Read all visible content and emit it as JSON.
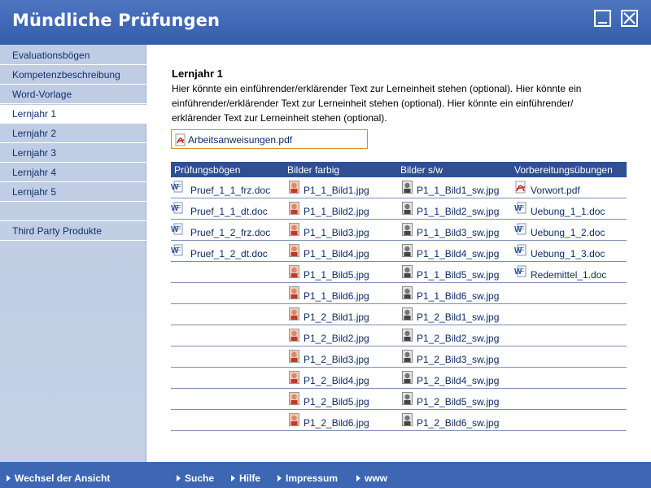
{
  "window": {
    "title": "Mündliche Prüfungen",
    "minimize_icon": "minimize-icon",
    "close_icon": "close-icon"
  },
  "sidebar": {
    "items": [
      {
        "label": "Evaluationsbögen",
        "active": false
      },
      {
        "label": "Kompetenzbeschreibung",
        "active": false
      },
      {
        "label": "Word-Vorlage",
        "active": false
      },
      {
        "label": "Lernjahr 1",
        "active": true
      },
      {
        "label": "Lernjahr 2",
        "active": false
      },
      {
        "label": "Lernjahr 3",
        "active": false
      },
      {
        "label": "Lernjahr 4",
        "active": false
      },
      {
        "label": "Lernjahr 5",
        "active": false
      },
      {
        "label": "Third Party Produkte",
        "active": false
      }
    ]
  },
  "main": {
    "title": "Lernjahr 1",
    "intro_line1": "Hier könnte ein einführender/erklärender Text zur Lerneinheit stehen (optional). Hier könnte ein",
    "intro_line2": "einführender/erklärender Text zur Lerneinheit stehen (optional). Hier könnte ein einführender/",
    "intro_line3": "erklärender Text zur Lerneinheit stehen (optional).",
    "featured_file": {
      "name": "Arbeitsanweisungen.pdf",
      "icon": "pdf-icon"
    },
    "table": {
      "headers": [
        "Prüfungsbögen",
        "Bilder farbig",
        "Bilder s/w",
        "Vorbereitungsübungen"
      ],
      "rows": [
        [
          "Pruef_1_1_frz.doc",
          "P1_1_Bild1.jpg",
          "P1_1_Bild1_sw.jpg",
          "Vorwort.pdf"
        ],
        [
          "Pruef_1_1_dt.doc",
          "P1_1_Bild2.jpg",
          "P1_1_Bild2_sw.jpg",
          "Uebung_1_1.doc"
        ],
        [
          "Pruef_1_2_frz.doc",
          "P1_1_Bild3.jpg",
          "P1_1_Bild3_sw.jpg",
          "Uebung_1_2.doc"
        ],
        [
          "Pruef_1_2_dt.doc",
          "P1_1_Bild4.jpg",
          "P1_1_Bild4_sw.jpg",
          "Uebung_1_3.doc"
        ],
        [
          "",
          "P1_1_Bild5.jpg",
          "P1_1_Bild5_sw.jpg",
          "Redemittel_1.doc"
        ],
        [
          "",
          "P1_1_Bild6.jpg",
          "P1_1_Bild6_sw.jpg",
          ""
        ],
        [
          "",
          "P1_2_Bild1.jpg",
          "P1_2_Bild1_sw.jpg",
          ""
        ],
        [
          "",
          "P1_2_Bild2.jpg",
          "P1_2_Bild2_sw.jpg",
          ""
        ],
        [
          "",
          "P1_2_Bild3.jpg",
          "P1_2_Bild3_sw.jpg",
          ""
        ],
        [
          "",
          "P1_2_Bild4.jpg",
          "P1_2_Bild4_sw.jpg",
          ""
        ],
        [
          "",
          "P1_2_Bild5.jpg",
          "P1_2_Bild5_sw.jpg",
          ""
        ],
        [
          "",
          "P1_2_Bild6.jpg",
          "P1_2_Bild6_sw.jpg",
          ""
        ]
      ]
    }
  },
  "footer": {
    "links": [
      "Wechsel der Ansicht",
      "Suche",
      "Hilfe",
      "Impressum",
      "www"
    ]
  },
  "colors": {
    "title_bar": "#3e67b6",
    "sidebar_bg": "#c4d0e6",
    "table_header": "#2f4f93",
    "footer": "#3d66b3",
    "link": "#0c2c68",
    "pdf_box_border": "#d98d2c"
  }
}
